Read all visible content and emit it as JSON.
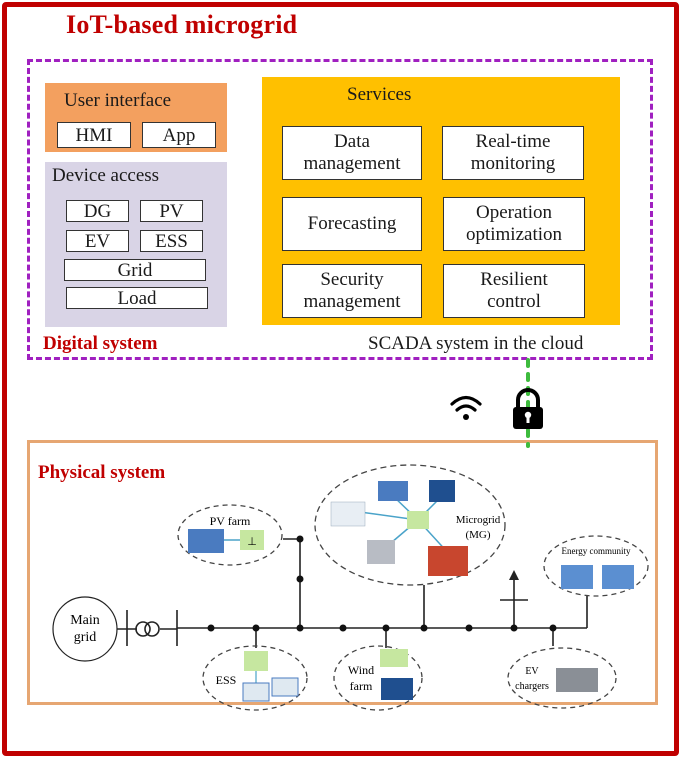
{
  "title": "IoT-based microgrid",
  "digital_system": {
    "label": "Digital system",
    "user_interface": {
      "title": "User interface",
      "items": [
        "HMI",
        "App"
      ]
    },
    "device_access": {
      "title": "Device access",
      "items": [
        "DG",
        "PV",
        "EV",
        "ESS",
        "Grid",
        "Load"
      ]
    },
    "services": {
      "title": "Services",
      "items": [
        {
          "line1": "Data",
          "line2": "management"
        },
        {
          "line1": "Real-time",
          "line2": "monitoring"
        },
        {
          "line1": "Forecasting",
          "line2": ""
        },
        {
          "line1": "Operation",
          "line2": "optimization"
        },
        {
          "line1": "Security",
          "line2": "management"
        },
        {
          "line1": "Resilient",
          "line2": "control"
        }
      ]
    },
    "scada_label": "SCADA system in the cloud"
  },
  "link": {
    "wifi_icon": "wifi-icon",
    "lock_icon": "lock-icon"
  },
  "physical_system": {
    "label": "Physical system",
    "main_grid": {
      "line1": "Main",
      "line2": "grid"
    },
    "pv_farm": "PV farm",
    "microgrid": {
      "line1": "Microgrid",
      "line2": "(MG)"
    },
    "energy_community": "Energy community",
    "ess": "ESS",
    "wind_farm": {
      "line1": "Wind",
      "line2": "farm"
    },
    "ev_chargers": {
      "line1": "EV",
      "line2": "chargers"
    }
  },
  "colors": {
    "frame": "#c00000",
    "digital_border": "#a020c0",
    "user_interface": "#f3a05f",
    "device_access": "#d9d4e6",
    "services": "#ffc000",
    "physical_border": "#e6a672",
    "secure_link": "#3dbb3d",
    "converter": "#c6e7a0"
  }
}
